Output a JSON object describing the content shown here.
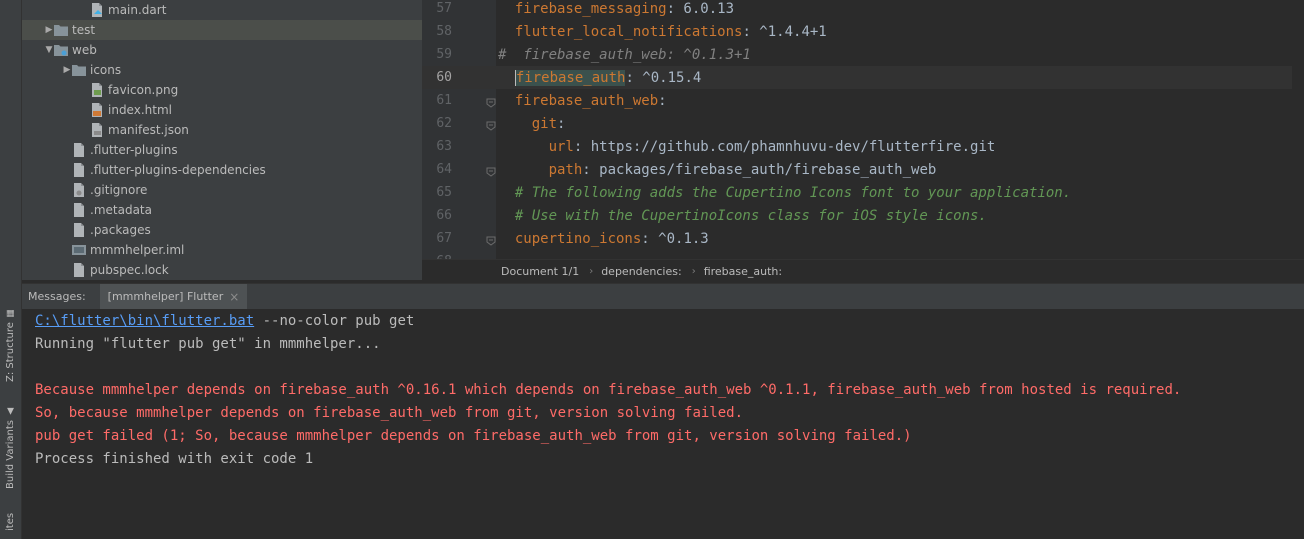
{
  "side_tabs": [
    {
      "label": "Z: Structure",
      "icon": "structure-icon"
    },
    {
      "label": "Build Variants",
      "icon": "android-icon"
    },
    {
      "label": "ites",
      "icon": "favorites-icon"
    }
  ],
  "project_tree": [
    {
      "label": "main.dart",
      "icon": "dart-file-icon",
      "depth": 3,
      "arrow": ""
    },
    {
      "label": "test",
      "icon": "folder-icon",
      "depth": 1,
      "arrow": "collapsed",
      "selected": true
    },
    {
      "label": "web",
      "icon": "web-folder-icon",
      "depth": 1,
      "arrow": "expanded"
    },
    {
      "label": "icons",
      "icon": "folder-icon",
      "depth": 2,
      "arrow": "collapsed"
    },
    {
      "label": "favicon.png",
      "icon": "image-file-icon",
      "depth": 3,
      "arrow": ""
    },
    {
      "label": "index.html",
      "icon": "html-file-icon",
      "depth": 3,
      "arrow": ""
    },
    {
      "label": "manifest.json",
      "icon": "json-file-icon",
      "depth": 3,
      "arrow": ""
    },
    {
      "label": ".flutter-plugins",
      "icon": "text-file-icon",
      "depth": 2,
      "arrow": ""
    },
    {
      "label": ".flutter-plugins-dependencies",
      "icon": "text-file-icon",
      "depth": 2,
      "arrow": ""
    },
    {
      "label": ".gitignore",
      "icon": "gitignore-file-icon",
      "depth": 2,
      "arrow": ""
    },
    {
      "label": ".metadata",
      "icon": "text-file-icon",
      "depth": 2,
      "arrow": ""
    },
    {
      "label": ".packages",
      "icon": "text-file-icon",
      "depth": 2,
      "arrow": ""
    },
    {
      "label": "mmmhelper.iml",
      "icon": "module-file-icon",
      "depth": 2,
      "arrow": ""
    },
    {
      "label": "pubspec.lock",
      "icon": "text-file-icon",
      "depth": 2,
      "arrow": ""
    }
  ],
  "editor": {
    "current_line": "60",
    "lines": [
      {
        "num": "57",
        "fold": false,
        "parts": [
          {
            "t": "  ",
            "c": "val"
          },
          {
            "t": "firebase_messaging",
            "c": "key"
          },
          {
            "t": ": 6.0.13",
            "c": "val"
          }
        ]
      },
      {
        "num": "58",
        "fold": false,
        "parts": [
          {
            "t": "  ",
            "c": "val"
          },
          {
            "t": "flutter_local_notifications",
            "c": "key"
          },
          {
            "t": ": ^1.4.4+1",
            "c": "val"
          }
        ]
      },
      {
        "num": "59",
        "fold": false,
        "parts": [
          {
            "t": "#  firebase_auth_web: ^0.1.3+1",
            "c": "cmt-gray"
          }
        ]
      },
      {
        "num": "60",
        "fold": false,
        "current": true,
        "parts": [
          {
            "t": "  ",
            "c": "val"
          },
          {
            "t": "firebase_auth",
            "c": "key match"
          },
          {
            "t": ": ^0.15.4",
            "c": "val"
          }
        ]
      },
      {
        "num": "61",
        "fold": true,
        "parts": [
          {
            "t": "  ",
            "c": "val"
          },
          {
            "t": "firebase_auth_web",
            "c": "key"
          },
          {
            "t": ":",
            "c": "val"
          }
        ]
      },
      {
        "num": "62",
        "fold": true,
        "parts": [
          {
            "t": "    ",
            "c": "val"
          },
          {
            "t": "git",
            "c": "key"
          },
          {
            "t": ":",
            "c": "val"
          }
        ]
      },
      {
        "num": "63",
        "fold": false,
        "parts": [
          {
            "t": "      ",
            "c": "val"
          },
          {
            "t": "url",
            "c": "key"
          },
          {
            "t": ": https://github.com/phamnhuvu-dev/flutterfire.git",
            "c": "val"
          }
        ]
      },
      {
        "num": "64",
        "fold": true,
        "parts": [
          {
            "t": "      ",
            "c": "val"
          },
          {
            "t": "path",
            "c": "key"
          },
          {
            "t": ": packages/firebase_auth/firebase_auth_web",
            "c": "val"
          }
        ]
      },
      {
        "num": "65",
        "fold": false,
        "parts": [
          {
            "t": "  # The following adds the Cupertino Icons font to your application.",
            "c": "cmt"
          }
        ]
      },
      {
        "num": "66",
        "fold": false,
        "parts": [
          {
            "t": "  # Use with the CupertinoIcons class for iOS style icons.",
            "c": "cmt"
          }
        ]
      },
      {
        "num": "67",
        "fold": true,
        "parts": [
          {
            "t": "  ",
            "c": "val"
          },
          {
            "t": "cupertino_icons",
            "c": "key"
          },
          {
            "t": ": ^0.1.3",
            "c": "val"
          }
        ]
      },
      {
        "num": "68",
        "fold": false,
        "parts": []
      }
    ]
  },
  "breadcrumbs": [
    "Document 1/1",
    "dependencies:",
    "firebase_auth:"
  ],
  "tool_window": {
    "title": "Messages:",
    "tab_label": "[mmmhelper] Flutter",
    "close_glyph": "×"
  },
  "console": [
    {
      "parts": [
        {
          "t": "C:\\flutter\\bin\\flutter.bat",
          "c": "c-link"
        },
        {
          "t": " --no-color pub get",
          "c": "c-normal"
        }
      ]
    },
    {
      "parts": [
        {
          "t": "Running \"flutter pub get\" in mmmhelper...",
          "c": "c-normal"
        }
      ]
    },
    {
      "parts": []
    },
    {
      "parts": [
        {
          "t": "Because mmmhelper depends on firebase_auth ^0.16.1 which depends on firebase_auth_web ^0.1.1, firebase_auth_web from hosted is required.",
          "c": "c-error"
        }
      ]
    },
    {
      "parts": [
        {
          "t": "So, because mmmhelper depends on firebase_auth_web from git, version solving failed.",
          "c": "c-error"
        }
      ]
    },
    {
      "parts": [
        {
          "t": "pub get failed (1; So, because mmmhelper depends on firebase_auth_web from git, version solving failed.)",
          "c": "c-error"
        }
      ]
    },
    {
      "parts": [
        {
          "t": "Process finished with exit code 1",
          "c": "c-normal"
        }
      ]
    }
  ],
  "colors": {
    "keyword": "#cc7832",
    "error": "#ff6b68",
    "link": "#589df6",
    "comment": "#629755"
  }
}
